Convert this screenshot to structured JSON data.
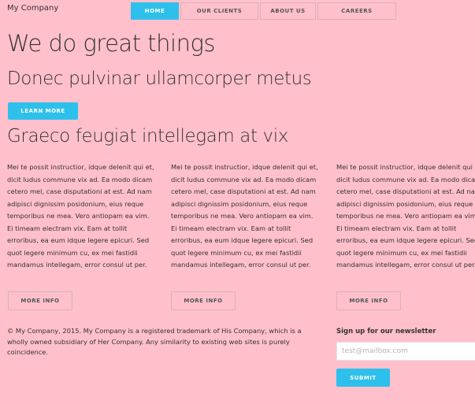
{
  "brand": "My Company",
  "nav": {
    "items": [
      "HOME",
      "OUR CLIENTS",
      "ABOUT US",
      "CAREERS"
    ],
    "active": "HOME"
  },
  "hero": {
    "title": "We do great things",
    "subtitle": "Donec pulvinar ullamcorper metus",
    "cta_label": "LEARN MORE"
  },
  "section": {
    "title": "Graeco feugiat intellegam at vix"
  },
  "columns": [
    {
      "text": "Mei te possit instructior, idque delenit qui et, dicit ludus commune vix ad. Ea modo dicam cetero mel, case disputationi at est. Ad nam adipisci dignissim posidonium, eius reque temporibus ne mea. Vero antiopam ea vim. Ei timeam electram vix. Eam at tollit erroribus, ea eum idque legere epicuri. Sed quot legere minimum cu, ex mei fastidii mandamus intellegam, error consul ut per.",
      "button_label": "MORE INFO"
    },
    {
      "text": "Mei te possit instructior, idque delenit qui et, dicit ludus commune vix ad. Ea modo dicam cetero mel, case disputationi at est. Ad nam adipisci dignissim posidonium, eius reque temporibus ne mea. Vero antiopam ea vim. Ei timeam electram vix. Eam at tollit erroribus, ea eum idque legere epicuri. Sed quot legere minimum cu, ex mei fastidii mandamus intellegam, error consul ut per.",
      "button_label": "MORE INFO"
    },
    {
      "text": "Mei te possit instructior, idque delenit qui et, dicit ludus commune vix ad. Ea modo dicam cetero mel, case disputationi at est. Ad nam adipisci dignissim posidonium, eius reque temporibus ne mea. Vero antiopam ea vim. Ei timeam electram vix. Eam at tollit erroribus, ea eum idque legere epicuri. Sed quot legere minimum cu, ex mei fastidii mandamus intellegam, error consul ut per.",
      "button_label": "MORE INFO"
    }
  ],
  "footer": {
    "text": "© My Company, 2015. My Company is a registered trademark of His Company, which is a wholly owned subsidiary of Her Company. Any similarity to existing web sites is purely coincidence.",
    "newsletter_label": "Sign up for our newsletter",
    "email_placeholder": "test@mailbox.com",
    "submit_label": "SUBMIT"
  },
  "colors": {
    "background": "#ffc0cb",
    "accent": "#2dc0ec"
  }
}
